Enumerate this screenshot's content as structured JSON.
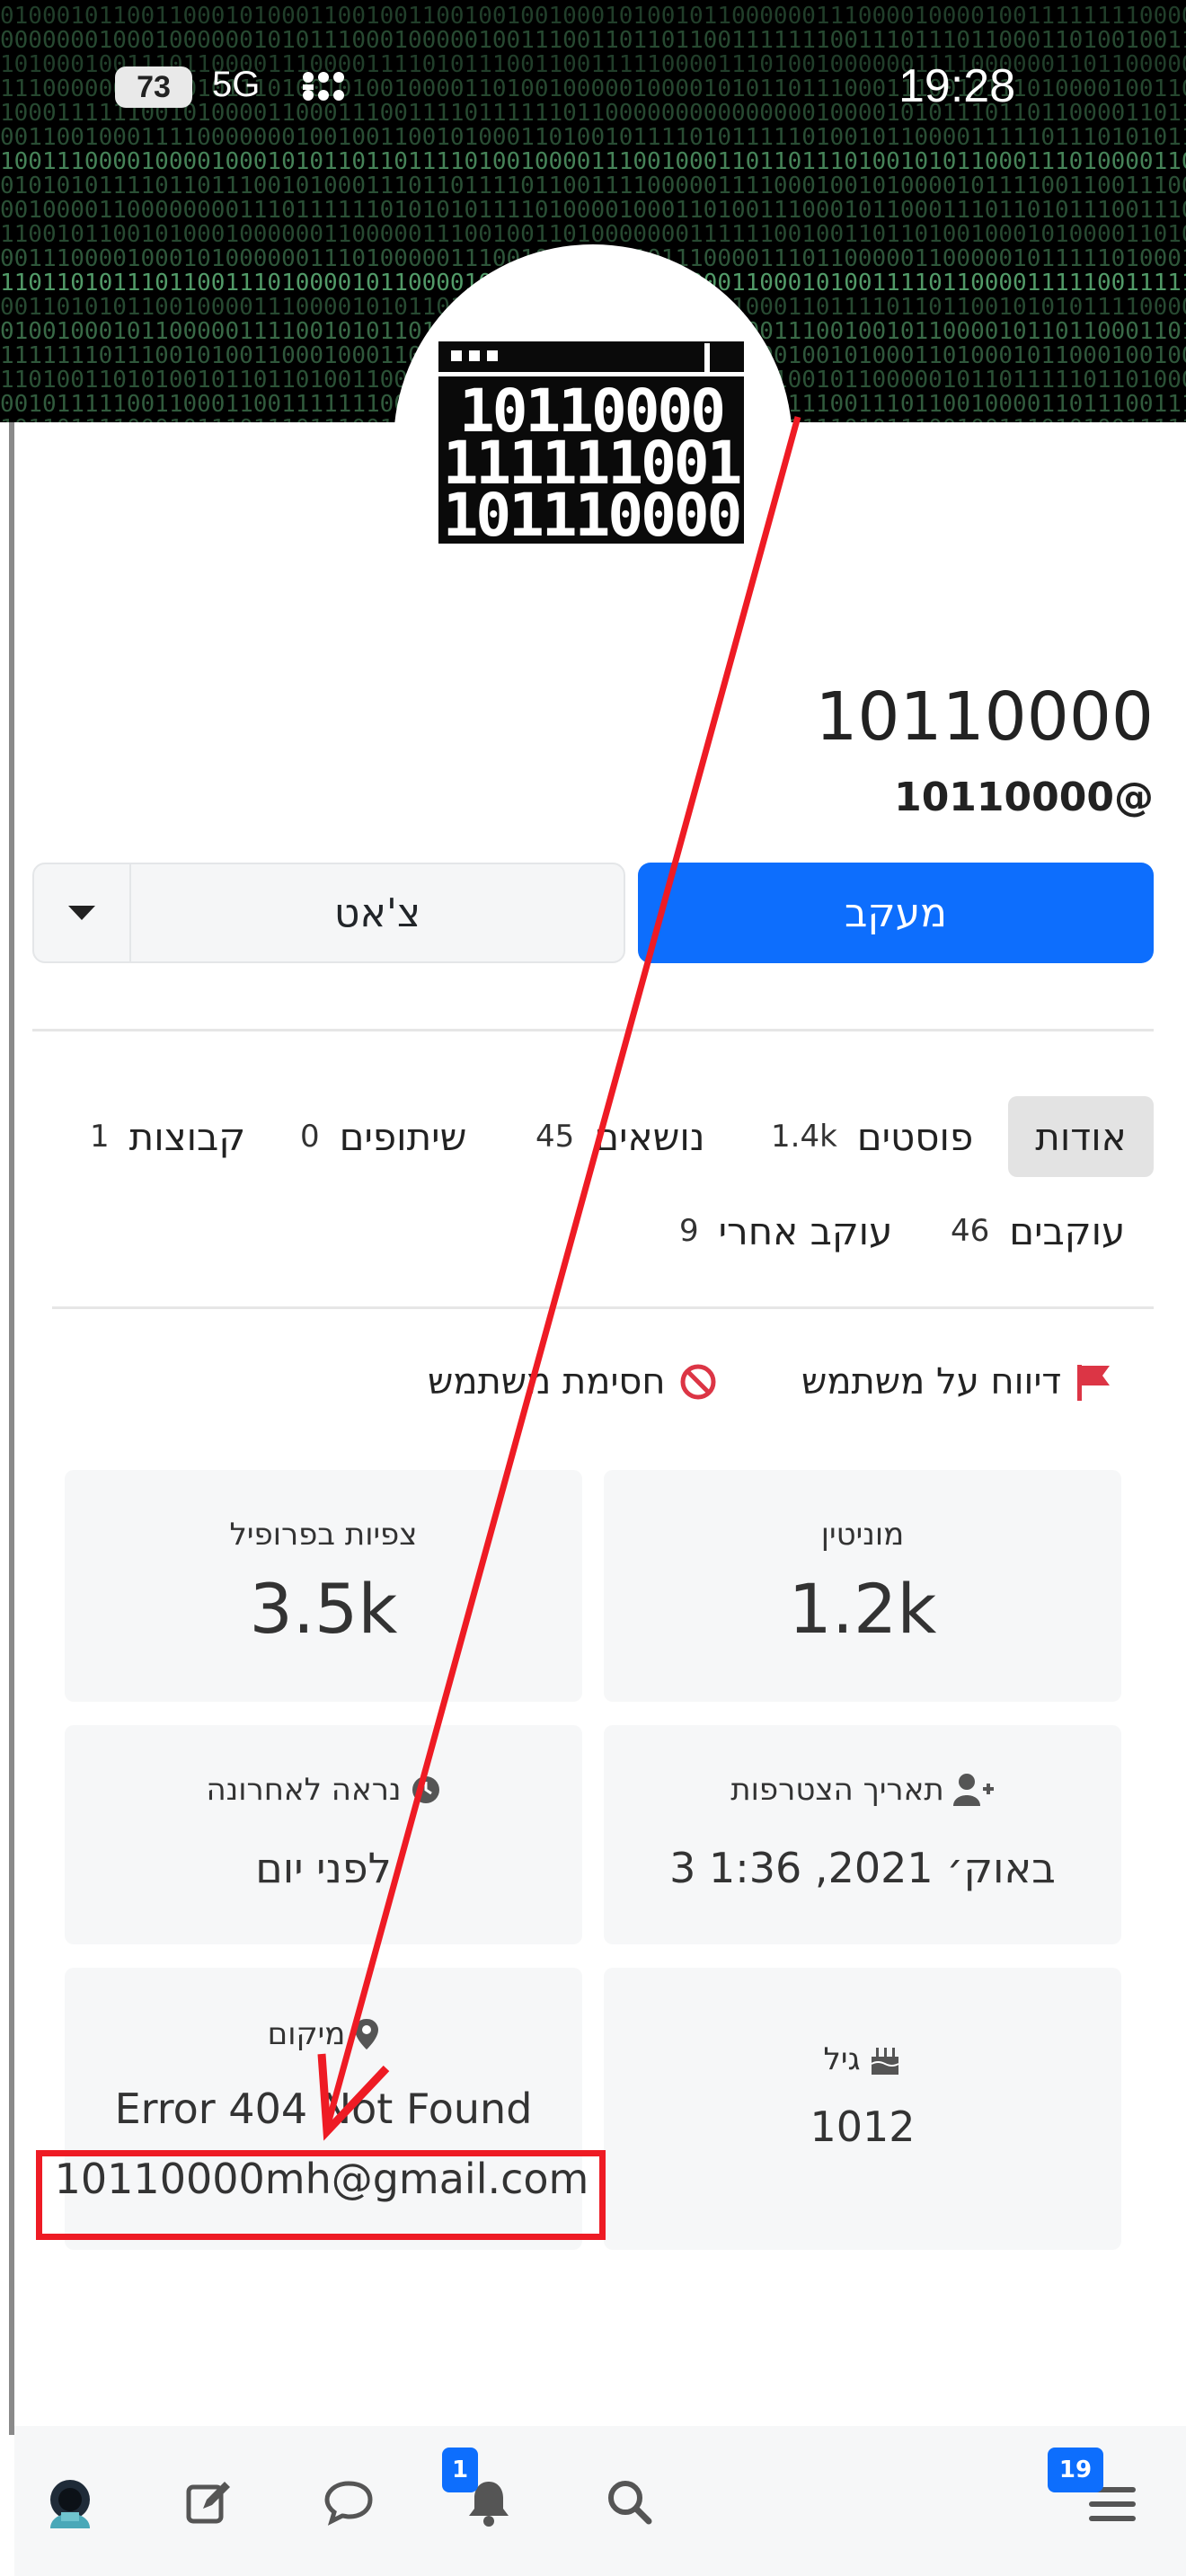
{
  "status_bar": {
    "time": "19:28",
    "battery": "73",
    "network": "5G"
  },
  "profile": {
    "display_name": "10110000",
    "handle": "10110000@",
    "avatar_lines": [
      "10110000",
      "111111001",
      "101110000"
    ]
  },
  "buttons": {
    "follow": "מעקב",
    "chat": "צ'אט"
  },
  "tabs": [
    {
      "label": "אודות",
      "count": ""
    },
    {
      "label": "פוסטים",
      "count": "1.4k"
    },
    {
      "label": "נושאים",
      "count": "45"
    },
    {
      "label": "שיתופים",
      "count": "0"
    },
    {
      "label": "קבוצות",
      "count": "1"
    },
    {
      "label": "עוקבים",
      "count": "46"
    },
    {
      "label": "עוקב אחרי",
      "count": "9"
    }
  ],
  "actions": {
    "report": "דיווח על משתמש",
    "block": "חסימת משתמש"
  },
  "stats": {
    "reputation": {
      "label": "מוניטין",
      "value": "1.2k"
    },
    "profile_views": {
      "label": "צפיות בפרופיל",
      "value": "3.5k"
    },
    "joined": {
      "label": "תאריך הצטרפות",
      "value": "3 באוק׳ 2021, 1:36"
    },
    "last_seen": {
      "label": "נראה לאחרונה",
      "value": "לפני יום"
    },
    "age": {
      "label": "גיל",
      "value": "1012"
    },
    "location": {
      "label": "מיקום",
      "value_line1": "Error 404 Not Found",
      "value_line2": "10110000mh@gmail.com"
    }
  },
  "nav": {
    "notifications_badge": "1",
    "menu_badge": "19"
  },
  "colors": {
    "primary": "#0d6efd",
    "annotation_red": "#ee1b24",
    "flag_red": "#dc3545"
  }
}
